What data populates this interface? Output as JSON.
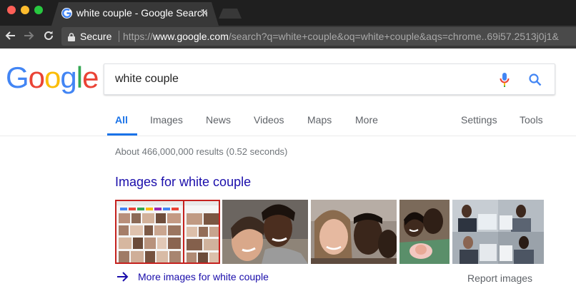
{
  "browser": {
    "tab_title": "white couple - Google Search",
    "tab_close": "✕",
    "secure_label": "Secure",
    "url_scheme": "https://",
    "url_host": "www.google.com",
    "url_rest": "/search?q=white+couple&oq=white+couple&aqs=chrome..69i57.2513j0j1&"
  },
  "logo": {
    "letters": [
      "G",
      "o",
      "o",
      "g",
      "l",
      "e"
    ],
    "colors": [
      "#4285f4",
      "#ea4335",
      "#fbbc05",
      "#4285f4",
      "#34a853",
      "#ea4335"
    ]
  },
  "search": {
    "query": "white couple"
  },
  "tabs": {
    "all": "All",
    "images": "Images",
    "news": "News",
    "videos": "Videos",
    "maps": "Maps",
    "more": "More",
    "settings": "Settings",
    "tools": "Tools"
  },
  "results": {
    "stats": "About 466,000,000 results (0.52 seconds)",
    "images_heading": "Images for white couple",
    "more_images": "More images for white couple",
    "report_images": "Report images"
  },
  "colors": {
    "accent": "#1a73e8",
    "link": "#1a0dab",
    "chrome_dark": "#1f1f1f",
    "chrome_toolbar": "#383838"
  }
}
